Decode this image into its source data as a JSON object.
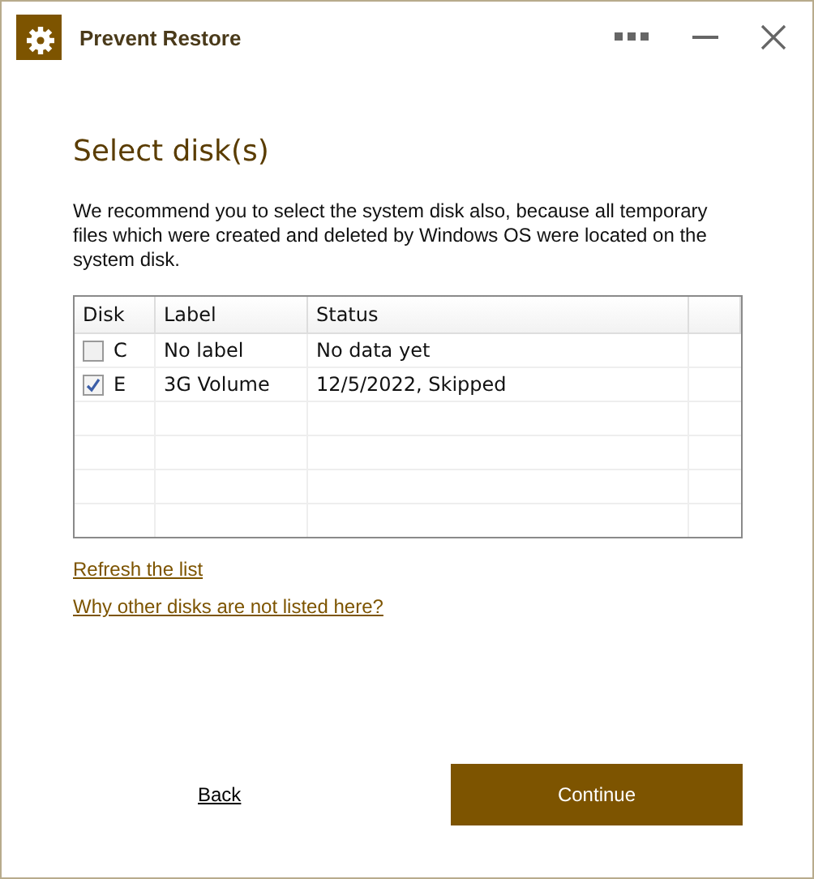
{
  "window": {
    "title": "Prevent Restore"
  },
  "heading": "Select disk(s)",
  "description": "We recommend you to select the system disk also, because all temporary files which were created and deleted by Windows OS were located on the system disk.",
  "table": {
    "columns": [
      "Disk",
      "Label",
      "Status"
    ],
    "rows": [
      {
        "disk": "C",
        "label": "No label",
        "status": "No data yet",
        "checked": false
      },
      {
        "disk": "E",
        "label": "3G Volume",
        "status": "12/5/2022, Skipped",
        "checked": true
      }
    ]
  },
  "links": [
    "Refresh the list",
    "Why other disks are not listed here?"
  ],
  "buttons": {
    "back": "Back",
    "continue": "Continue"
  }
}
